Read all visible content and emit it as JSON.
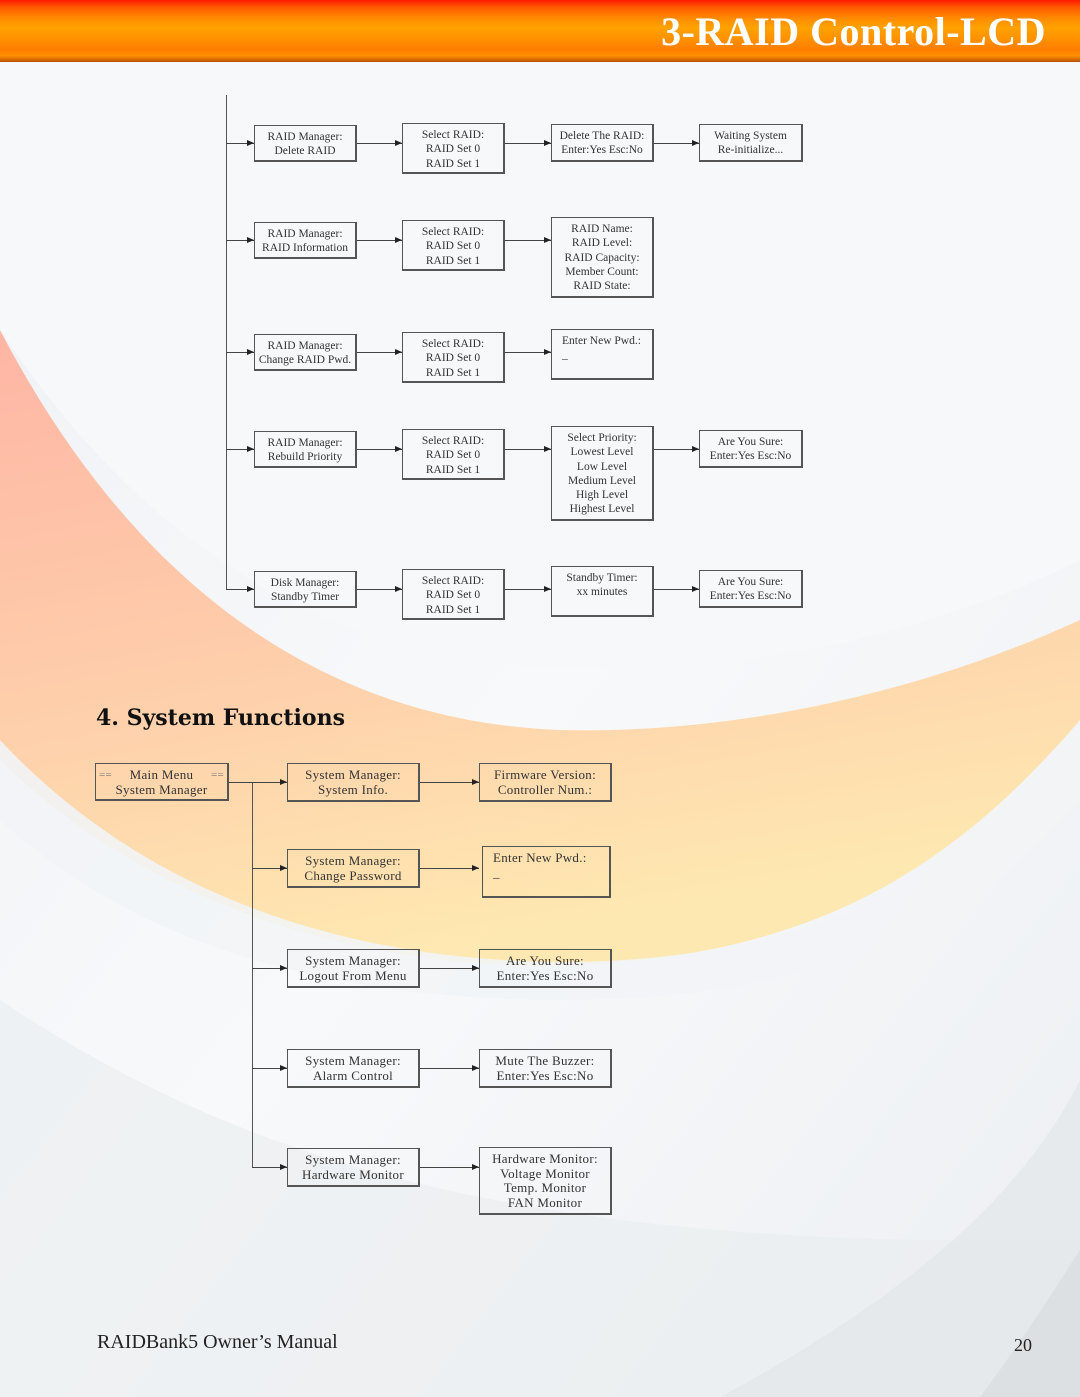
{
  "header": {
    "title": "3-RAID Control-LCD",
    "gradient_colors": [
      "#ff1a00",
      "#ff8c00",
      "#ffa200",
      "#b85200"
    ]
  },
  "raid_flow": {
    "rows": [
      {
        "boxes": [
          [
            "RAID Manager:",
            "Delete RAID"
          ],
          [
            "Select RAID:",
            "RAID Set 0",
            "RAID Set 1"
          ],
          [
            "Delete The RAID:",
            "Enter:Yes Esc:No"
          ],
          [
            "Waiting System",
            "Re-initialize..."
          ]
        ]
      },
      {
        "boxes": [
          [
            "RAID Manager:",
            "RAID Information"
          ],
          [
            "Select RAID:",
            "RAID Set 0",
            "RAID Set 1"
          ],
          [
            "RAID Name:",
            "RAID Level:",
            "RAID Capacity:",
            "Member Count:",
            "RAID State:"
          ]
        ]
      },
      {
        "boxes": [
          [
            "RAID Manager:",
            "Change RAID Pwd."
          ],
          [
            "Select RAID:",
            "RAID Set 0",
            "RAID Set 1"
          ],
          [
            "Enter New Pwd.:",
            "_"
          ]
        ]
      },
      {
        "boxes": [
          [
            "RAID Manager:",
            "Rebuild Priority"
          ],
          [
            "Select RAID:",
            "RAID Set 0",
            "RAID Set 1"
          ],
          [
            "Select Priority:",
            "Lowest Level",
            "Low Level",
            "Medium Level",
            "High Level",
            "Highest Level"
          ],
          [
            "Are You Sure:",
            "Enter:Yes Esc:No"
          ]
        ]
      },
      {
        "boxes": [
          [
            "Disk Manager:",
            "Standby Timer"
          ],
          [
            "Select RAID:",
            "RAID Set 0",
            "RAID Set 1"
          ],
          [
            "Standby Timer:",
            "xx minutes"
          ],
          [
            "Are You Sure:",
            "Enter:Yes Esc:No"
          ]
        ]
      }
    ]
  },
  "section": {
    "title": "4. System Functions"
  },
  "system_flow": {
    "root": {
      "marker_left": "==",
      "marker_right": "==",
      "lines": [
        "Main Menu",
        "System Manager"
      ]
    },
    "rows": [
      {
        "boxes": [
          [
            "System Manager:",
            "System Info."
          ],
          [
            "Firmware Version:",
            "Controller Num.:"
          ]
        ]
      },
      {
        "boxes": [
          [
            "System Manager:",
            "Change Password"
          ],
          [
            "Enter New Pwd.:",
            "_"
          ]
        ]
      },
      {
        "boxes": [
          [
            "System Manager:",
            "Logout From Menu"
          ],
          [
            "Are You Sure:",
            "Enter:Yes Esc:No"
          ]
        ]
      },
      {
        "boxes": [
          [
            "System Manager:",
            "Alarm Control"
          ],
          [
            "Mute The Buzzer:",
            "Enter:Yes Esc:No"
          ]
        ]
      },
      {
        "boxes": [
          [
            "System Manager:",
            "Hardware Monitor"
          ],
          [
            "Hardware Monitor:",
            "Voltage Monitor",
            "Temp. Monitor",
            "FAN Monitor"
          ]
        ]
      }
    ]
  },
  "footer": {
    "manual_title": "RAIDBank5 Owner’s Manual",
    "page_number": "20"
  }
}
